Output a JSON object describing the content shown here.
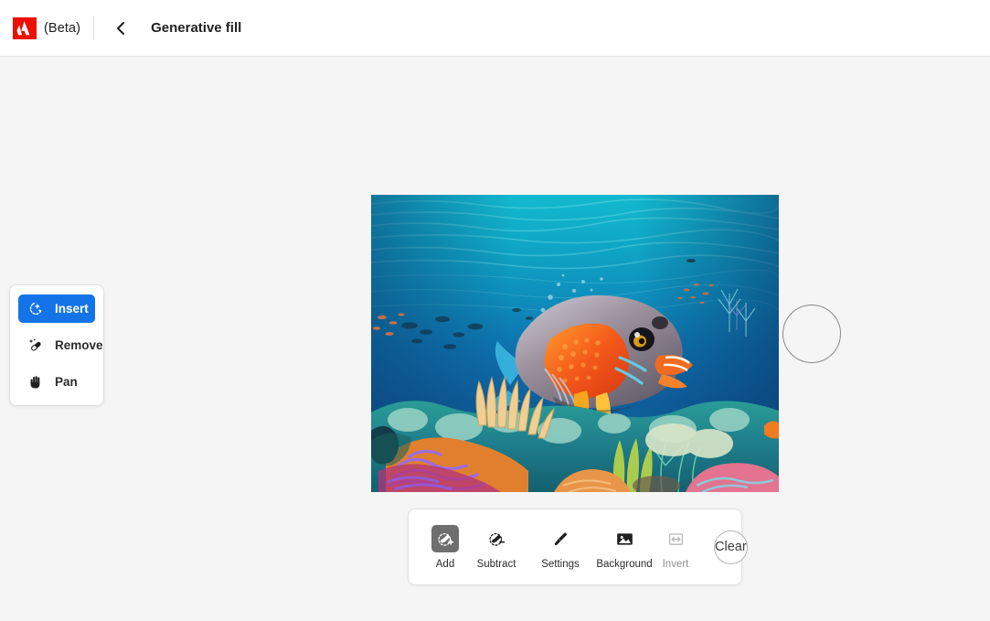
{
  "header": {
    "logo_icon": "adobe-logo-icon",
    "beta_label": "(Beta)",
    "back_icon": "chevron-left-icon",
    "title": "Generative fill"
  },
  "tool_panel": {
    "items": [
      {
        "label": "Insert",
        "icon": "sparkle-circle-icon",
        "selected": true
      },
      {
        "label": "Remove",
        "icon": "healing-brush-icon",
        "selected": false
      },
      {
        "label": "Pan",
        "icon": "hand-icon",
        "selected": false
      }
    ]
  },
  "canvas": {
    "image_alt": "underwater coral reef scene with orange tropical fish",
    "brush_cursor": "brush-size-cursor"
  },
  "bottom_bar": {
    "tools": [
      {
        "label": "Add",
        "icon": "brush-add-icon",
        "active": true,
        "disabled": false
      },
      {
        "label": "Subtract",
        "icon": "brush-subtract-icon",
        "active": false,
        "disabled": false
      },
      {
        "label": "Settings",
        "icon": "paintbrush-icon",
        "active": false,
        "disabled": false
      },
      {
        "label": "Background",
        "icon": "image-icon",
        "active": false,
        "disabled": false
      },
      {
        "label": "Invert",
        "icon": "invert-arrows-icon",
        "active": false,
        "disabled": true
      }
    ],
    "clear_label": "Clear"
  },
  "colors": {
    "accent_blue": "#1473e6",
    "adobe_red": "#eb1000",
    "page_background": "#f5f5f5",
    "header_background": "#ffffff",
    "active_icon_bg": "#6e6e6e"
  }
}
